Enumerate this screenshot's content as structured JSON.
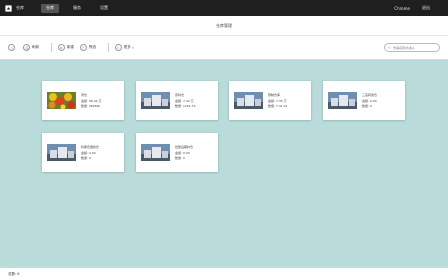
{
  "topbar": {
    "brand": "仓库",
    "nav": [
      "仓库",
      "服务",
      "设置"
    ],
    "active_index": 1,
    "user": "Chrome",
    "logout": "退出"
  },
  "header": {
    "title": "仓库管理"
  },
  "toolbar": {
    "refresh": "刷新",
    "add": "新建",
    "filter": "筛选",
    "more": "更多",
    "search_placeholder": "仓库名称/负责人"
  },
  "cards": [
    {
      "title": "周仓",
      "amount": "金额: 96.44 万",
      "qty": "数量: 28264k",
      "image": "flower-photo"
    },
    {
      "title": "原料仓",
      "amount": "金额: 7.44 万",
      "qty": "数量: 1261.79",
      "image": "building-photo"
    },
    {
      "title": "预制仓库",
      "amount": "金额: 7.35 万",
      "qty": "数量: 7.41 k4",
      "image": "building-photo"
    },
    {
      "title": "三宫转卖仓",
      "amount": "金额: 0.00",
      "qty": "数量: 0",
      "image": "building-photo"
    },
    {
      "title": "料果仓废新仓",
      "amount": "金额: 0.00",
      "qty": "数量: 0",
      "image": "building-photo"
    },
    {
      "title": "批量后期料仓",
      "amount": "金额: 0.00",
      "qty": "数量: 0",
      "image": "building-photo"
    }
  ],
  "statusbar": {
    "total": "总数: 6"
  }
}
